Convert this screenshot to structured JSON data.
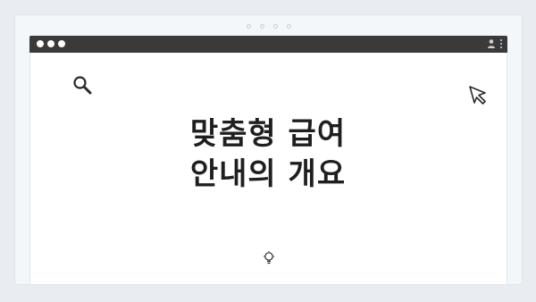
{
  "carousel": {
    "dots": 4
  },
  "window": {
    "titlebar_color": "#3a3a3a",
    "traffic_lights": [
      "#ffffff",
      "#ffffff",
      "#ffffff"
    ]
  },
  "icons": {
    "top_left": "search-icon",
    "top_right": "cursor-icon",
    "bottom": "lightbulb-icon",
    "titlebar_right": [
      "profile-icon",
      "kebab-menu-icon"
    ]
  },
  "main": {
    "title_line1": "맞춤형 급여",
    "title_line2": "안내의 개요"
  },
  "colors": {
    "background": "#e9edf2",
    "card": "#f4f7fa",
    "window": "#ffffff",
    "text": "#1f1f1f"
  }
}
